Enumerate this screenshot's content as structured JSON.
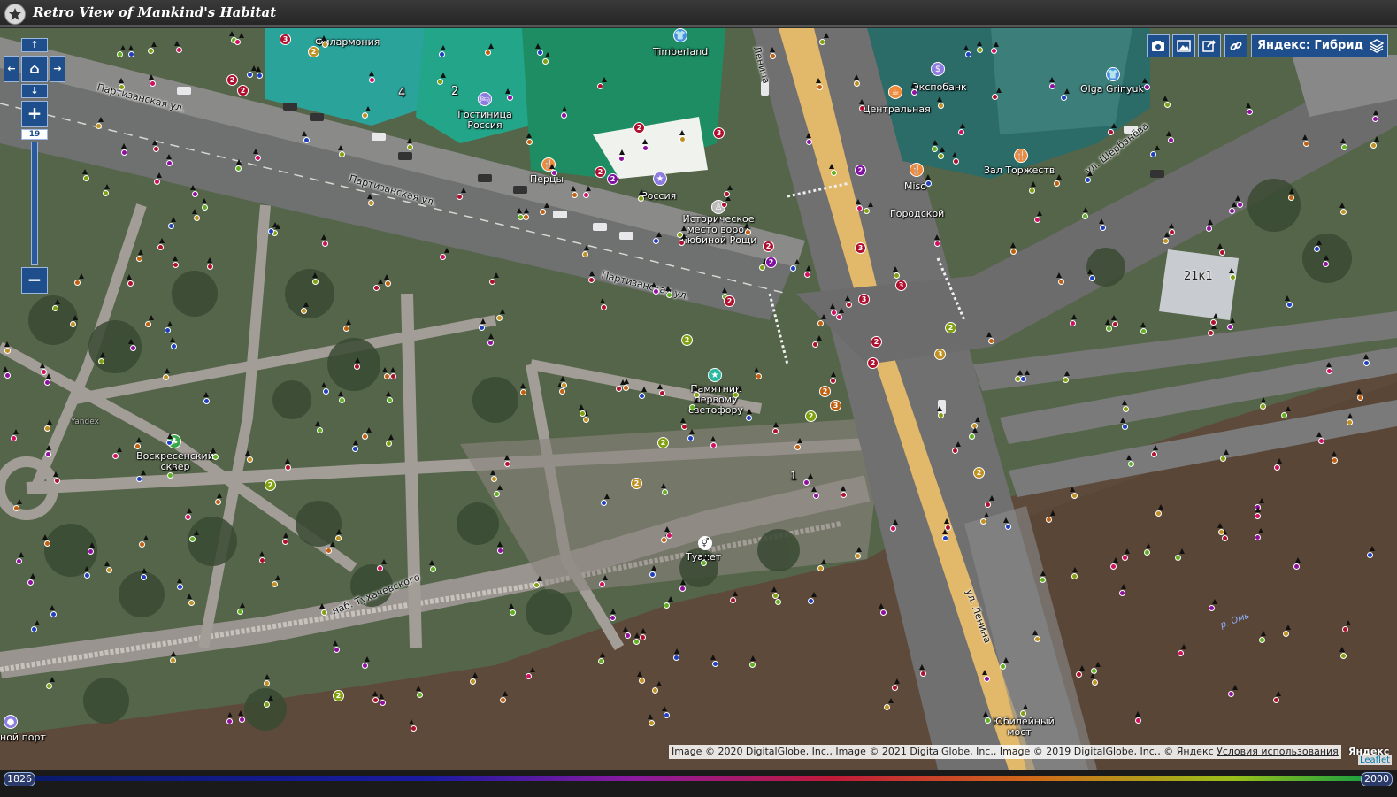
{
  "app": {
    "title": "Retro View of Mankind's Habitat"
  },
  "zoom": {
    "level": "19",
    "in_label": "+",
    "out_label": "−"
  },
  "nav": {
    "up": "↑",
    "down": "↓",
    "left": "←",
    "right": "→",
    "home": "⌂"
  },
  "toolbar": {
    "buttons": [
      {
        "name": "camera-icon"
      },
      {
        "name": "image-icon"
      },
      {
        "name": "share-icon"
      },
      {
        "name": "link-icon"
      }
    ],
    "layer_label": "Яндекс: Гибрид",
    "layer_icon": "layers-icon"
  },
  "map_labels": {
    "filarmonia": "Филармония",
    "timberland": "Timberland",
    "gostinica": "Гостиница Россия",
    "percy": "Перцы",
    "rossia": "Россия",
    "historic": "Историческое место ворот Любиной Рощи",
    "ekspobank": "Экспобанк",
    "centralnaya": "Центральная",
    "olga": "Olga Grinyuk",
    "zal": "Зал Торжеств",
    "miso": "Miso",
    "gorodskoi": "Городской",
    "k21": "21к1",
    "pamyatnik": "Памятник первому светофору",
    "voskresensky": "Воскресенский сквер",
    "tualet": "Туалет",
    "yubileyny": "Юбилейный мост",
    "port": "ной порт",
    "num4": "4",
    "num2": "2",
    "num1": "1",
    "river": "р. Омь",
    "yandex_wm": "Yandex"
  },
  "streets": {
    "partizanskaya1": "Партизанская ул.",
    "partizanskaya2": "Партизанская ул.",
    "partizanskaya3": "Партизанская ул.",
    "lenina1": "Ленина",
    "lenina2": "ул. Ленина",
    "scherbaneva": "ул. Щербанёва",
    "tuhachevskogo": "наб. Тухачевского"
  },
  "attribution": {
    "text": "Image © 2020 DigitalGlobe, Inc., Image © 2021 DigitalGlobe, Inc., Image © 2019 DigitalGlobe, Inc., © Яндекс ",
    "link": "Условия использования",
    "yandex": "Яндекс",
    "leaflet": "Leaflet"
  },
  "timeline": {
    "start_year": "1826",
    "end_year": "2000"
  },
  "colors": {
    "accent": "#1f4e8c",
    "poi_orange": "#f08a3a",
    "poi_purple": "#8e7be0",
    "poi_blue": "#4a90e2",
    "poi_green": "#3aa84a",
    "poi_teal": "#2bb8a0"
  }
}
